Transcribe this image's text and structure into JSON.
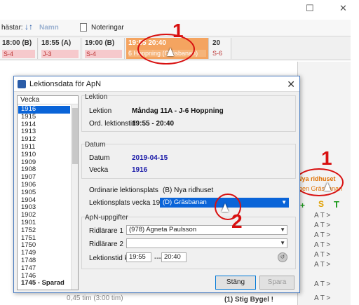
{
  "window": {
    "minimize": "☐",
    "close": "✕"
  },
  "toolbar": {
    "horses_label": "hästar:",
    "sort_label": "Namn",
    "notes_label": "Noteringar"
  },
  "slots": [
    {
      "time": "18:00 (B)",
      "sub": "S-4"
    },
    {
      "time": "18:55 (A)",
      "sub": "J-3"
    },
    {
      "time": "19:00 (B)",
      "sub": "S-4"
    },
    {
      "time": "19:55 20:40",
      "sub": "6 Hoppning (Gräsbanan)"
    },
    {
      "time": "20",
      "sub": "S-6"
    }
  ],
  "annotations": {
    "one": "1",
    "two": "2"
  },
  "right_panel": {
    "nya_ridhuset": "Nya ridhuset",
    "igen": "igen Gräsbanan",
    "rows": [
      "A T >",
      "A T >",
      "A T >",
      "A T >",
      "A T >",
      "A T >",
      "A T >",
      "A T >"
    ]
  },
  "bottom": {
    "duration": "0,45 tim  (3:00 tim)",
    "rider_name": "(1) Stig Bygel !"
  },
  "dialog": {
    "title": "Lektionsdata för ApN",
    "close": "✕",
    "week_header": "Vecka",
    "weeks": [
      "1916",
      "1915",
      "1914",
      "1913",
      "1912",
      "1911",
      "1910",
      "1909",
      "1908",
      "1907",
      "1906",
      "1905",
      "1904",
      "1903",
      "1902",
      "1901",
      "1752",
      "1751",
      "1750",
      "1749",
      "1748",
      "1747",
      "1746",
      "1745 - Sparad"
    ],
    "lesson_group": "Lektion",
    "lesson_label": "Lektion",
    "lesson_value": "Måndag 11A  - J-6 Hoppning",
    "ord_time_label": "Ord. lektionstid",
    "ord_time_value": "19:55 - 20:40",
    "date_group": "Datum",
    "date_label": "Datum",
    "date_value": "2019-04-15",
    "week_label": "Vecka",
    "week_value": "1916",
    "ord_place_label": "Ordinarie lektionsplats",
    "ord_place_value": "(B) Nya ridhuset",
    "place_week_label": "Lektionsplats vecka 1916",
    "place_week_value": "(D) Gräsbanan",
    "apn_group": "ApN-uppgifter",
    "rider1_label": "Ridlärare 1",
    "rider1_value": "(978) Agneta Paulsson",
    "rider2_label": "Ridlärare 2",
    "rider2_value": "",
    "time_label": "Lektionstid kl",
    "time_from": "19:55",
    "time_sep": "---",
    "time_to": "20:40",
    "close_button": "Stäng",
    "save_button": "Spara"
  }
}
